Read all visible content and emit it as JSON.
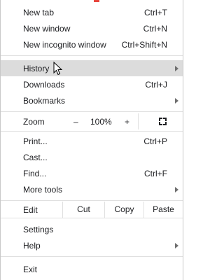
{
  "menu": {
    "items": [
      {
        "label": "New tab",
        "shortcut": "Ctrl+T"
      },
      {
        "label": "New window",
        "shortcut": "Ctrl+N"
      },
      {
        "label": "New incognito window",
        "shortcut": "Ctrl+Shift+N"
      },
      {
        "label": "History",
        "shortcut": ""
      },
      {
        "label": "Downloads",
        "shortcut": "Ctrl+J"
      },
      {
        "label": "Bookmarks",
        "shortcut": ""
      },
      {
        "label": "Print...",
        "shortcut": "Ctrl+P"
      },
      {
        "label": "Cast...",
        "shortcut": ""
      },
      {
        "label": "Find...",
        "shortcut": "Ctrl+F"
      },
      {
        "label": "More tools",
        "shortcut": ""
      },
      {
        "label": "Settings",
        "shortcut": ""
      },
      {
        "label": "Help",
        "shortcut": ""
      },
      {
        "label": "Exit",
        "shortcut": ""
      }
    ],
    "zoom": {
      "label": "Zoom",
      "minus": "–",
      "value": "100%",
      "plus": "+"
    },
    "edit": {
      "label": "Edit",
      "cut": "Cut",
      "copy": "Copy",
      "paste": "Paste"
    }
  },
  "colors": {
    "hover_bg": "#dcdcdc",
    "accent": "#e8453c"
  }
}
